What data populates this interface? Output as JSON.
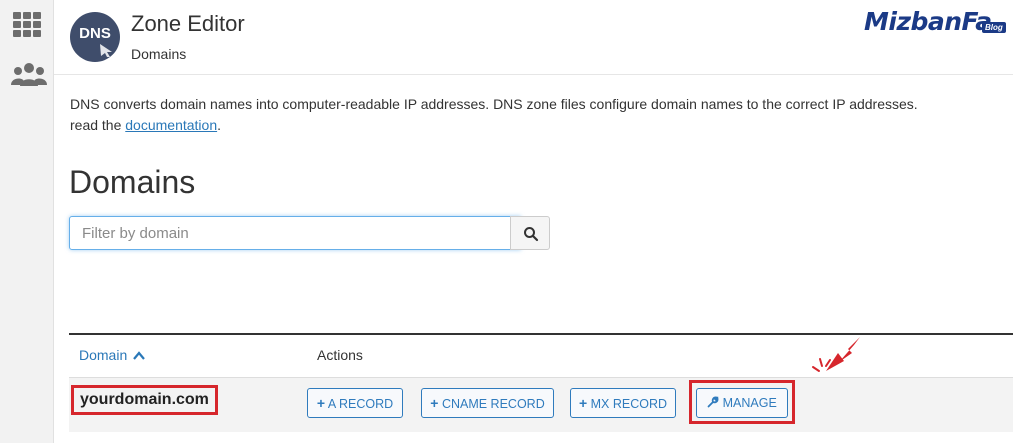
{
  "colors": {
    "accent": "#2f7bbd",
    "highlight": "#d6262c",
    "brand": "#1b3a86",
    "logo_bg": "#3f4d6b"
  },
  "sidebar": {
    "items": [
      {
        "icon": "grid-icon"
      },
      {
        "icon": "users-icon"
      }
    ]
  },
  "header": {
    "logo_text": "DNS",
    "title": "Zone Editor",
    "subtitle": "Domains",
    "brand": "MizbanFa",
    "brand_badge": "Blog"
  },
  "intro": {
    "text": "DNS converts domain names into computer-readable IP addresses. DNS zone files configure domain names to the correct IP addresses.",
    "read_prefix": "read the",
    "link": "documentation",
    "suffix": "."
  },
  "page_title": "Domains",
  "filter": {
    "placeholder": "Filter by domain",
    "value": ""
  },
  "table": {
    "columns": {
      "domain": "Domain",
      "actions": "Actions"
    },
    "rows": [
      {
        "domain": "yourdomain.com",
        "actions": {
          "a_record": "A RECORD",
          "cname_record": "CNAME RECORD",
          "mx_record": "MX RECORD",
          "manage": "MANAGE"
        }
      }
    ]
  }
}
